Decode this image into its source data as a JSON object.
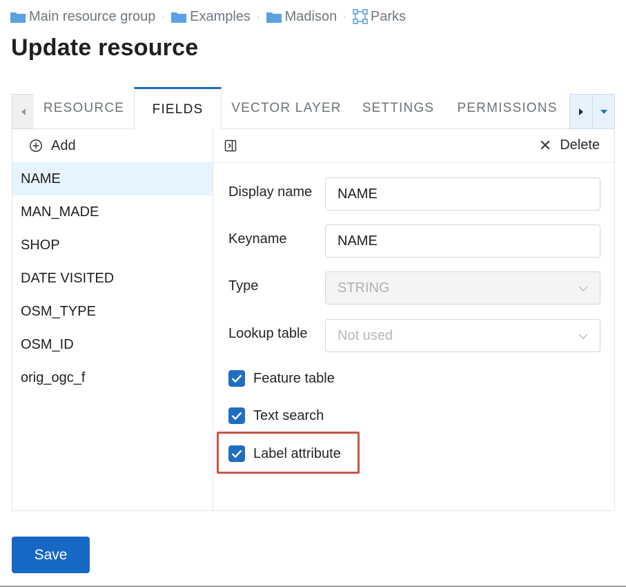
{
  "breadcrumb": {
    "items": [
      {
        "label": "Main resource group",
        "icon": "folder-icon"
      },
      {
        "label": "Examples",
        "icon": "folder-icon"
      },
      {
        "label": "Madison",
        "icon": "folder-icon"
      },
      {
        "label": "Parks",
        "icon": "vector-layer-icon"
      }
    ],
    "separator": "·"
  },
  "page": {
    "title": "Update resource"
  },
  "tabs": {
    "items": [
      "RESOURCE",
      "FIELDS",
      "VECTOR LAYER",
      "SETTINGS",
      "PERMISSIONS"
    ],
    "active": "FIELDS"
  },
  "fields_panel": {
    "add_label": "Add",
    "items": [
      "NAME",
      "MAN_MADE",
      "SHOP",
      "DATE VISITED",
      "OSM_TYPE",
      "OSM_ID",
      "orig_ogc_f"
    ],
    "selected": "NAME"
  },
  "editor": {
    "delete_label": "Delete",
    "display_name": {
      "label": "Display name",
      "value": "NAME"
    },
    "keyname": {
      "label": "Keyname",
      "value": "NAME"
    },
    "type": {
      "label": "Type",
      "value": "STRING"
    },
    "lookup_table": {
      "label": "Lookup table",
      "placeholder": "Not used"
    },
    "checkboxes": {
      "feature_table": {
        "label": "Feature table",
        "checked": true
      },
      "text_search": {
        "label": "Text search",
        "checked": true
      },
      "label_attribute": {
        "label": "Label attribute",
        "checked": true
      }
    }
  },
  "actions": {
    "save_label": "Save"
  },
  "colors": {
    "accent": "#1668c4",
    "selected_row": "#e6f4ff",
    "highlight": "#c9544a",
    "folder": "#5aa1e3"
  }
}
